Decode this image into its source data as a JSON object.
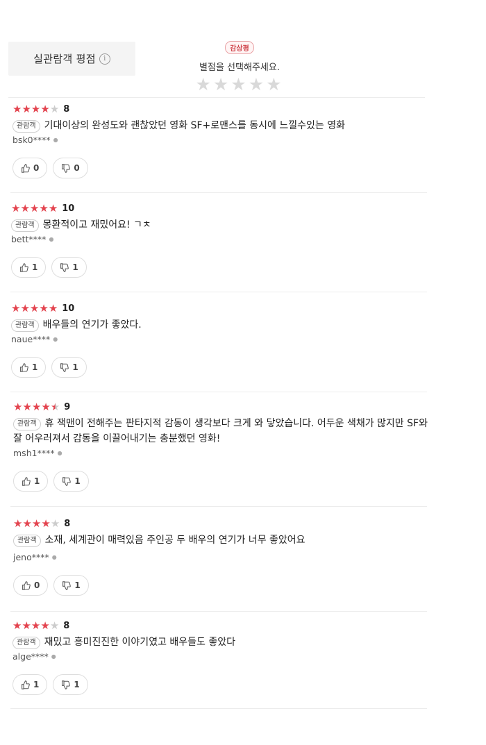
{
  "header": {
    "tab_label": "실관람객 평점",
    "info_icon": "i",
    "badge": "감상평",
    "prompt": "별점을 선택해주세요.",
    "rate_stars": [
      "★",
      "★",
      "★",
      "★",
      "★"
    ]
  },
  "reviews": [
    {
      "stars": 4,
      "half": false,
      "score": "8",
      "tag": "관람객",
      "text": "기대이상의 완성도와 괜찮았던 영화 SF+로맨스를 동시에 느낄수있는 영화",
      "author": "bsk0****",
      "likes": "0",
      "dislikes": "0"
    },
    {
      "stars": 5,
      "half": false,
      "score": "10",
      "tag": "관람객",
      "text": "몽환적이고 재밌어요!  ㄱㅊ",
      "author": "bett****",
      "likes": "1",
      "dislikes": "1"
    },
    {
      "stars": 5,
      "half": false,
      "score": "10",
      "tag": "관람객",
      "text": "배우들의 연기가 좋았다.",
      "author": "naue****",
      "likes": "1",
      "dislikes": "1"
    },
    {
      "stars": 4,
      "half": true,
      "score": "9",
      "tag": "관람객",
      "text": "휴 잭맨이 전해주는 판타지적 감동이 생각보다 크게 와 닿았습니다. 어두운 색채가 많지만 SF와  잘 어우러져서 감동을 이끌어내기는 충분했던 영화!",
      "author": "msh1****",
      "likes": "1",
      "dislikes": "1"
    },
    {
      "stars": 4,
      "half": false,
      "score": "8",
      "tag": "관람객",
      "text": "소재, 세계관이 매력있음  주인공 두 배우의 연기가 너무 좋았어요",
      "author": "jeno****",
      "likes": "0",
      "dislikes": "1"
    },
    {
      "stars": 4,
      "half": false,
      "score": "8",
      "tag": "관람객",
      "text": "재밌고 흥미진진한 이야기였고 배우들도 좋았다",
      "author": "alge****",
      "likes": "1",
      "dislikes": "1"
    }
  ]
}
